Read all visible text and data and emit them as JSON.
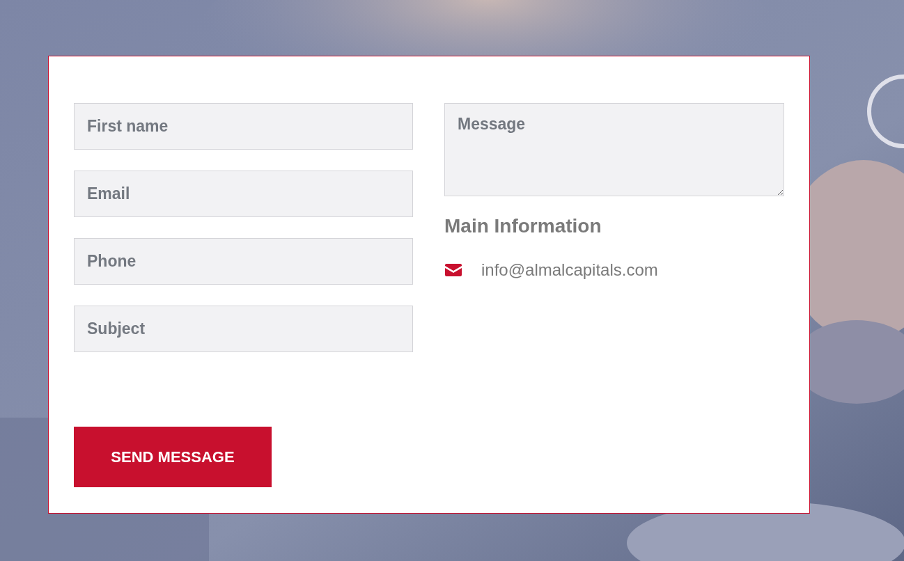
{
  "form": {
    "fields": [
      {
        "kind": "input",
        "placeholder": "First name"
      },
      {
        "kind": "input",
        "placeholder": "Email"
      },
      {
        "kind": "input",
        "placeholder": "Phone"
      },
      {
        "kind": "input",
        "placeholder": "Subject"
      }
    ],
    "message": {
      "placeholder": "Message"
    },
    "button": "SEND MESSAGE"
  },
  "info": {
    "title": "Main Information",
    "email": "info@almalcapitals.com"
  }
}
